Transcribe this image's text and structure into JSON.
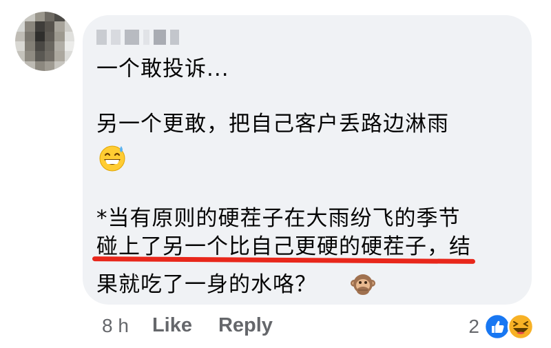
{
  "comment": {
    "lines": [
      "一个敢投诉...",
      "另一个更敢，把自己客户丢路边淋雨",
      "*当有原则的硬茬子在大雨纷飞的季节",
      "碰上了另一个比自己更硬的硬茬子，结",
      "果就吃了一身的水咯？"
    ],
    "emojis": [
      "grinning-sweat-emoji",
      "speak-no-evil-monkey-emoji"
    ],
    "highlight_color": "#e8271b"
  },
  "footer": {
    "time": "8 h",
    "like_label": "Like",
    "reply_label": "Reply",
    "reaction_count": "2",
    "reaction_icons": [
      "like-reaction-icon",
      "haha-reaction-icon"
    ]
  },
  "colors": {
    "bubble": "#f0f2f5",
    "text": "#050505",
    "secondary": "#65676b",
    "like_blue": "#1877f2",
    "haha_yellow": "#f7b125"
  }
}
